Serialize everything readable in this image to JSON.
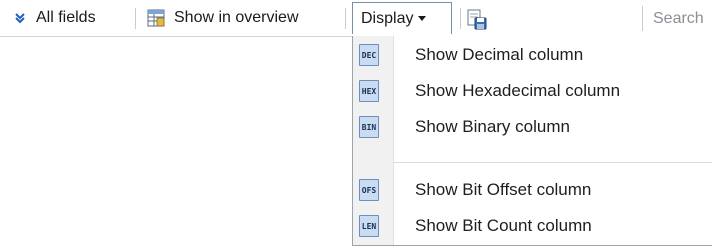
{
  "toolbar": {
    "all_fields": "All fields",
    "show_in_overview": "Show in overview",
    "display": "Display",
    "search_placeholder": "Search"
  },
  "menu": {
    "items": [
      {
        "badge": "DEC",
        "label": "Show Decimal column"
      },
      {
        "badge": "HEX",
        "label": "Show Hexadecimal column"
      },
      {
        "badge": "BIN",
        "label": "Show Binary column"
      },
      {
        "badge": "OFS",
        "label": "Show Bit Offset column"
      },
      {
        "badge": "LEN",
        "label": "Show Bit Count column"
      }
    ]
  },
  "colors": {
    "accent": "#1f5fbf",
    "badge_fill": "#c9dcf2",
    "badge_border": "#6d8fbe"
  },
  "icons": [
    "double-chevron-down-icon",
    "overview-grid-icon",
    "dropdown-arrow-icon",
    "save-disk-icon"
  ]
}
